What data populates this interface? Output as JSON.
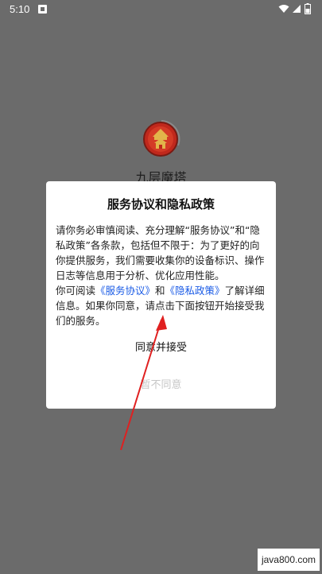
{
  "status_bar": {
    "time": "5:10"
  },
  "app": {
    "name": "九层魔塔"
  },
  "dialog": {
    "title": "服务协议和隐私政策",
    "para1": "请你务必审慎阅读、充分理解“服务协议”和“隐私政策”各条款，包括但不限于：为了更好的向你提供服务，我们需要收集你的设备标识、操作日志等信息用于分析、优化应用性能。",
    "para2_prefix": "你可阅读",
    "link_service": "《服务协议》",
    "and": "和",
    "link_privacy": "《隐私政策》",
    "para2_suffix": "了解详细信息。如果你同意，请点击下面按钮开始接受我们的服务。",
    "agree_label": "同意并接受",
    "disagree_label": "暂不同意"
  },
  "watermark": {
    "text": "java800.com"
  },
  "colors": {
    "overlay": "#6b6b6b",
    "link": "#1a5be6",
    "arrow": "#e02020",
    "logo_red": "#c0281c",
    "logo_gold": "#e2b44a"
  }
}
